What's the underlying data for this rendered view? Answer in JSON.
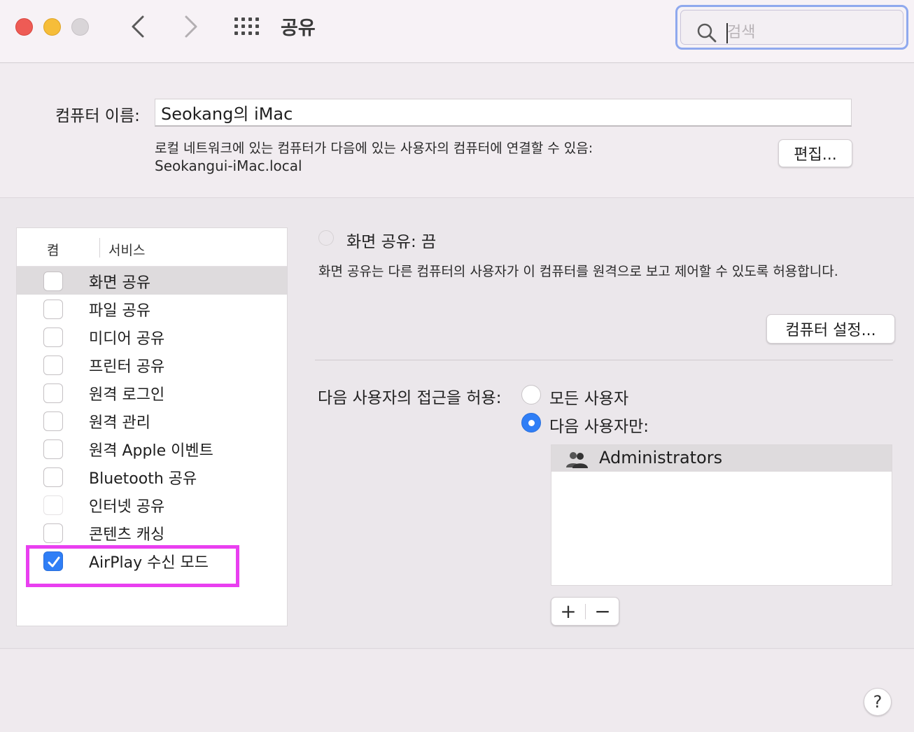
{
  "window": {
    "title": "공유",
    "search_placeholder": "검색"
  },
  "computer_name": {
    "label": "컴퓨터 이름:",
    "value": "Seokang의 iMac",
    "description": "로컬 네트워크에 있는 컴퓨터가 다음에 있는 사용자의 컴퓨터에 연결할 수 있음:",
    "hostname": "Seokangui-iMac.local",
    "edit_button": "편집..."
  },
  "services": {
    "header_on": "켬",
    "header_service": "서비스",
    "items": [
      {
        "label": "화면 공유",
        "checked": false,
        "selected": true
      },
      {
        "label": "파일 공유",
        "checked": false
      },
      {
        "label": "미디어 공유",
        "checked": false
      },
      {
        "label": "프린터 공유",
        "checked": false
      },
      {
        "label": "원격 로그인",
        "checked": false
      },
      {
        "label": "원격 관리",
        "checked": false
      },
      {
        "label": "원격 Apple 이벤트",
        "checked": false
      },
      {
        "label": "Bluetooth 공유",
        "checked": false
      },
      {
        "label": "인터넷 공유",
        "checked": false,
        "disabled": true
      },
      {
        "label": "콘텐츠 캐싱",
        "checked": false
      },
      {
        "label": "AirPlay 수신 모드",
        "checked": true
      }
    ]
  },
  "detail": {
    "status": "화면 공유: 끔",
    "description": "화면 공유는 다른 컴퓨터의 사용자가 이 컴퓨터를 원격으로 보고 제어할 수 있도록 허용합니다.",
    "settings_button": "컴퓨터 설정...",
    "access_label": "다음 사용자의 접근을 허용:",
    "option_all": "모든 사용자",
    "option_only": "다음 사용자만:",
    "users": [
      "Administrators"
    ],
    "add_label": "+",
    "remove_label": "−"
  },
  "help_label": "?",
  "colors": {
    "accent": "#2f7ef6",
    "highlight": "#e93ff0",
    "close": "#ee5b55",
    "minimize": "#f6bd39"
  }
}
